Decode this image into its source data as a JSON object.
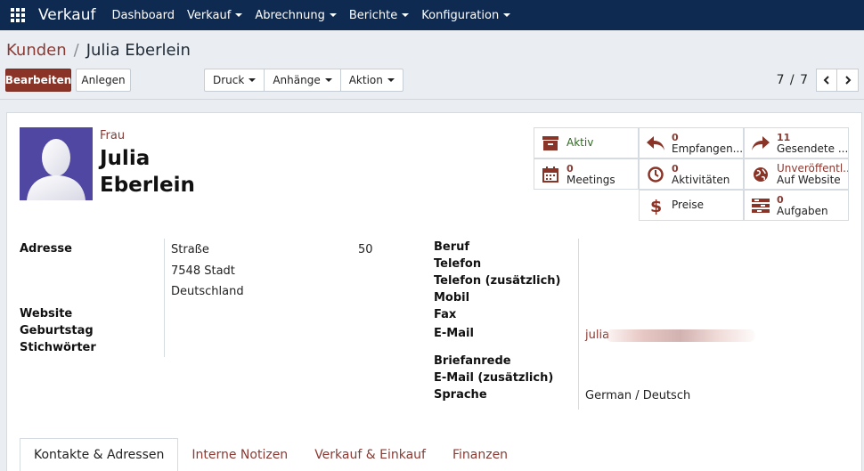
{
  "navbar": {
    "app_name": "Verkauf",
    "menu": [
      {
        "label": "Dashboard"
      },
      {
        "label": "Verkauf"
      },
      {
        "label": "Abrechnung"
      },
      {
        "label": "Berichte"
      },
      {
        "label": "Konfiguration"
      }
    ]
  },
  "breadcrumb": {
    "parent": "Kunden",
    "separator": "/",
    "current": "Julia Eberlein"
  },
  "toolbar": {
    "edit_label": "Bearbeiten",
    "create_label": "Anlegen",
    "print_label": "Druck",
    "attachments_label": "Anhänge",
    "action_label": "Aktion"
  },
  "pager": {
    "value": "7 / 7"
  },
  "partner": {
    "title": "Frau",
    "first_name": "Julia",
    "last_name": "Eberlein"
  },
  "smart_buttons": {
    "active": {
      "label": "Aktiv"
    },
    "received": {
      "count": "0",
      "label": "Empfangen..."
    },
    "sent": {
      "count": "11",
      "label": "Gesendete ..."
    },
    "meetings": {
      "count": "0",
      "label": "Meetings"
    },
    "activities": {
      "count": "0",
      "label": "Aktivitäten"
    },
    "website": {
      "status": "Unveröffentl...",
      "label": "Auf Website"
    },
    "pricelists": {
      "label": "Preise"
    },
    "tasks": {
      "count": "0",
      "label": "Aufgaben"
    }
  },
  "fields_left": {
    "address_label": "Adresse",
    "street": "Straße",
    "street_number": "50",
    "city_line": "7548 Stadt",
    "country": "Deutschland",
    "website_label": "Website",
    "birthday_label": "Geburtstag",
    "tags_label": "Stichwörter"
  },
  "fields_right": {
    "job_label": "Beruf",
    "phone_label": "Telefon",
    "phone2_label": "Telefon (zusätzlich)",
    "mobile_label": "Mobil",
    "fax_label": "Fax",
    "email_label": "E-Mail",
    "email_value": "julia",
    "salutation_label": "Briefanrede",
    "email2_label": "E-Mail (zusätzlich)",
    "language_label": "Sprache",
    "language_value": "German / Deutsch"
  },
  "tabs": [
    {
      "label": "Kontakte & Adressen"
    },
    {
      "label": "Interne Notizen"
    },
    {
      "label": "Verkauf & Einkauf"
    },
    {
      "label": "Finanzen"
    }
  ],
  "colors": {
    "navbar_bg": "#0f2a50",
    "primary": "#8a3327",
    "link": "#8a3a33",
    "active_green": "#2e6b1f",
    "avatar_bg": "#5047a3"
  },
  "icons": {
    "apps": "apps-grid-icon",
    "active": "archive-icon",
    "received": "reply-icon",
    "sent": "share-icon",
    "meetings": "calendar-icon",
    "activities": "clock-icon",
    "website": "globe-icon",
    "pricelists": "dollar-icon",
    "tasks": "tasks-icon"
  }
}
